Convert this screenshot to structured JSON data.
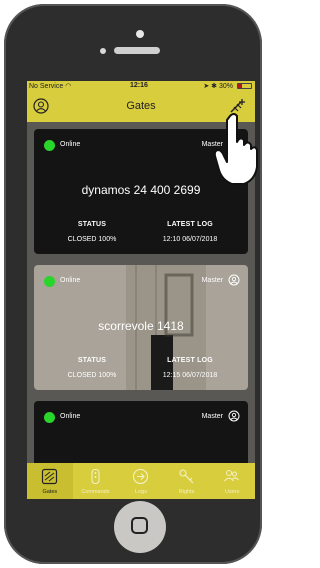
{
  "status_bar": {
    "carrier": "No Service",
    "time": "12:16",
    "battery": "30%"
  },
  "nav": {
    "title": "Gates",
    "profile_icon": "profile-icon",
    "add_gate_icon": "add-gate-icon"
  },
  "cards": [
    {
      "status_label": "Online",
      "role": "Master",
      "name": "dynamos 24 400 2699",
      "status_heading": "STATUS",
      "status_value": "CLOSED 100%",
      "log_heading": "LATEST LOG",
      "log_value": "12:10 06/07/2018"
    },
    {
      "status_label": "Online",
      "role": "Master",
      "name": "scorrevole 1418",
      "status_heading": "STATUS",
      "status_value": "CLOSED 100%",
      "log_heading": "LATEST LOG",
      "log_value": "12:15 06/07/2018"
    },
    {
      "status_label": "Online",
      "role": "Master"
    }
  ],
  "tabs": [
    {
      "label": "Gates",
      "icon": "gate-icon",
      "active": true
    },
    {
      "label": "Commands",
      "icon": "remote-icon",
      "active": false
    },
    {
      "label": "Logs",
      "icon": "logs-icon",
      "active": false
    },
    {
      "label": "Rights",
      "icon": "key-icon",
      "active": false
    },
    {
      "label": "Users",
      "icon": "users-icon",
      "active": false
    }
  ],
  "colors": {
    "accent": "#d8cd3c",
    "online": "#29d42b",
    "card_dark": "#141414"
  }
}
